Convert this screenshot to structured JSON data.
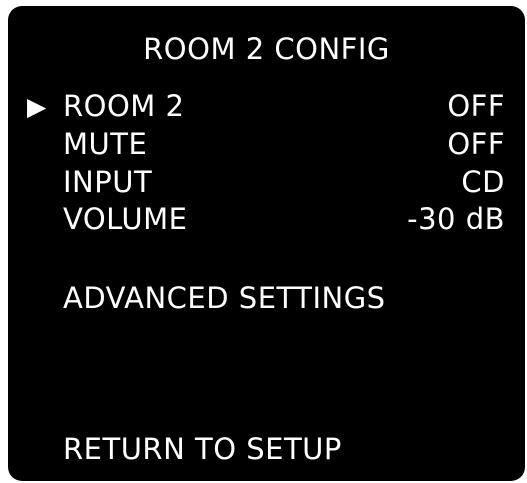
{
  "menu": {
    "title": "ROOM 2 CONFIG",
    "pointer": "▶",
    "items": [
      {
        "label": "ROOM 2",
        "value": "OFF"
      },
      {
        "label": "MUTE",
        "value": "OFF"
      },
      {
        "label": "INPUT",
        "value": "CD"
      },
      {
        "label": "VOLUME",
        "value": "-30 dB"
      }
    ],
    "advanced_label": "ADVANCED SETTINGS",
    "return_label": "RETURN TO SETUP"
  }
}
